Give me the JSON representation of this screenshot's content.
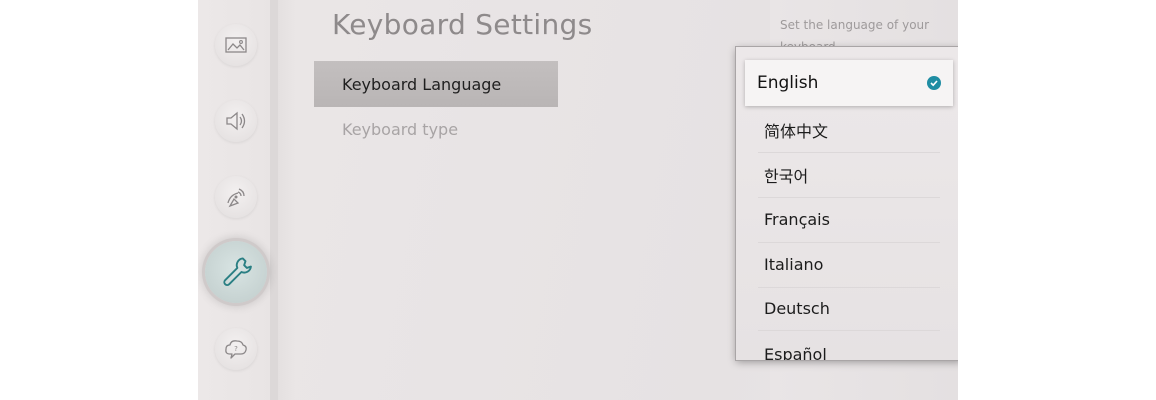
{
  "header": {
    "title": "Keyboard Settings"
  },
  "menu": {
    "items": [
      {
        "label": "Keyboard Language",
        "selected": true
      },
      {
        "label": "Keyboard type",
        "selected": false
      }
    ]
  },
  "dropdown": {
    "selected": "English",
    "options": [
      "English",
      "简体中文",
      "한국어",
      "Français",
      "Italiano",
      "Deutsch",
      "Español"
    ]
  },
  "help": {
    "text": "Set the language of your keyboard."
  },
  "sidebar": {
    "icons": [
      {
        "icon": "picture-icon",
        "active": false
      },
      {
        "icon": "sound-icon",
        "active": false
      },
      {
        "icon": "broadcasting-icon",
        "active": false
      },
      {
        "icon": "wrench-icon",
        "active": true
      },
      {
        "icon": "support-icon",
        "active": false
      }
    ]
  },
  "colors": {
    "accent": "#1f8da3",
    "selected_row": "#bbb7b7",
    "active_icon": "#2a7f83"
  }
}
